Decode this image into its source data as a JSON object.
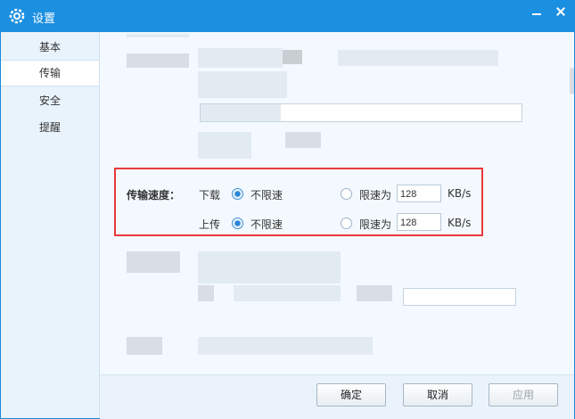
{
  "window": {
    "title": "设置",
    "icon": "gear-icon",
    "controls": [
      "minimize-icon",
      "close-icon"
    ]
  },
  "sidebar": {
    "items": [
      {
        "label": "基本",
        "active": false
      },
      {
        "label": "传输",
        "active": true
      },
      {
        "label": "安全",
        "active": false
      },
      {
        "label": "提醒",
        "active": false
      }
    ]
  },
  "transfer_speed": {
    "section_label": "传输速度：",
    "download": {
      "label": "下载",
      "unlimited_label": "不限速",
      "limit_label": "限速为",
      "limit_value": "128",
      "unit": "KB/s",
      "selected": "unlimited"
    },
    "upload": {
      "label": "上传",
      "unlimited_label": "不限速",
      "limit_label": "限速为",
      "limit_value": "128",
      "unit": "KB/s",
      "selected": "unlimited"
    }
  },
  "footer": {
    "ok_label": "确定",
    "cancel_label": "取消",
    "apply_label": "应用"
  },
  "colors": {
    "titlebar": "#1b8fe0",
    "highlight_border": "#e8393d",
    "accent": "#2d86d6"
  }
}
